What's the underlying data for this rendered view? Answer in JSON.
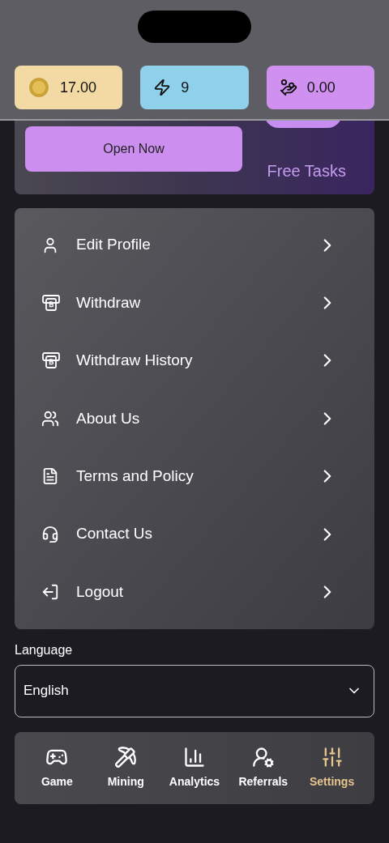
{
  "balances": [
    {
      "value": "17.00",
      "color": "#f3d9a4"
    },
    {
      "value": "9",
      "color": "#8fd0ea"
    },
    {
      "value": "0.00",
      "color": "#cf90ef"
    }
  ],
  "banner": {
    "button": "Open Now",
    "caption": "Free Tasks"
  },
  "menu": [
    {
      "label": "Edit Profile"
    },
    {
      "label": "Withdraw"
    },
    {
      "label": "Withdraw History"
    },
    {
      "label": "About Us"
    },
    {
      "label": "Terms and Policy"
    },
    {
      "label": "Contact Us"
    },
    {
      "label": "Logout"
    }
  ],
  "language": {
    "label": "Language",
    "value": "English"
  },
  "nav": [
    {
      "label": "Game",
      "selected": false
    },
    {
      "label": "Mining",
      "selected": false
    },
    {
      "label": "Analytics",
      "selected": false
    },
    {
      "label": "Referrals",
      "selected": false
    },
    {
      "label": "Settings",
      "selected": true
    }
  ]
}
